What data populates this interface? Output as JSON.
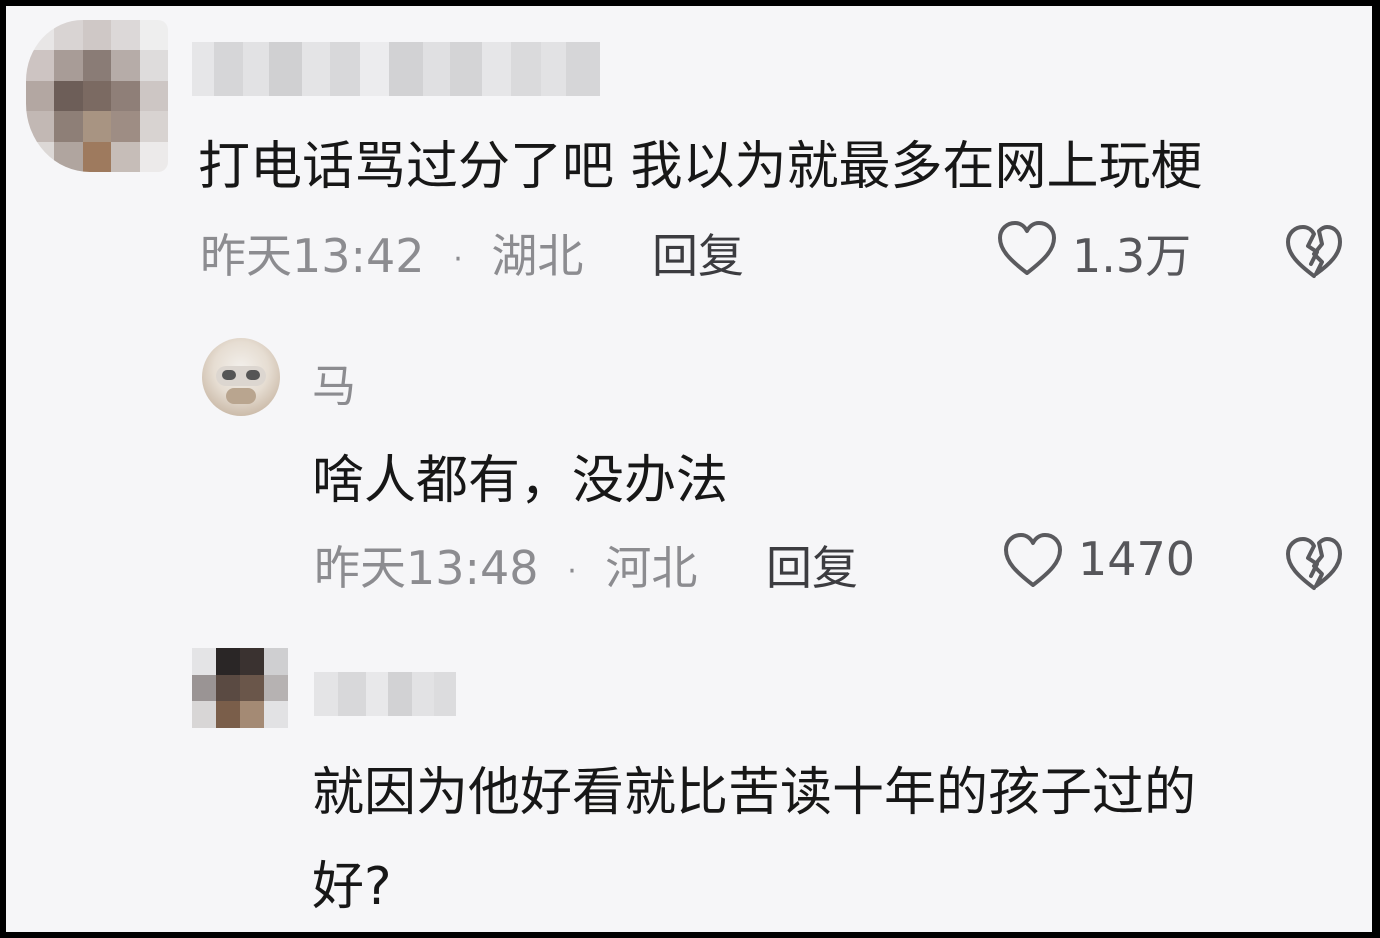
{
  "comments": [
    {
      "text": "打电话骂过分了吧 我以为就最多在网上玩梗",
      "time": "昨天13:42",
      "sep": "·",
      "location": "湖北",
      "reply": "回复",
      "likes": "1.3万"
    },
    {
      "username": "马",
      "text": "啥人都有，没办法",
      "time": "昨天13:48",
      "sep": "·",
      "location": "河北",
      "reply": "回复",
      "likes": "1470"
    },
    {
      "text_line1": "就因为他好看就比苦读十年的孩子过的",
      "text_line2": "好?"
    }
  ],
  "icons": [
    "heart-outline-icon",
    "broken-heart-icon"
  ],
  "colors": {
    "background": "#f6f6f8",
    "border": "#000000",
    "text": "#171717",
    "meta": "#8c8c90"
  }
}
